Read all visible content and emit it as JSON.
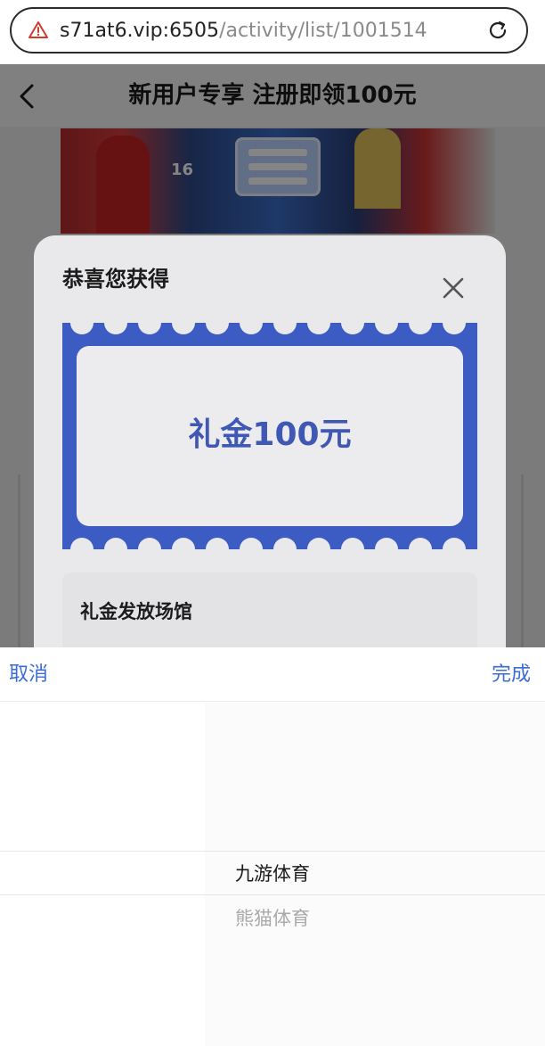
{
  "browser": {
    "url_host": "s71at6.vip:6505",
    "url_path": "/activity/list/1001514",
    "warn_icon": "warning-icon",
    "reload_icon": "reload-icon"
  },
  "page": {
    "title": "新用户专享 注册即领100元",
    "back_icon": "back-chevron-icon",
    "banner_number": "16"
  },
  "modal": {
    "title": "恭喜您获得",
    "close_icon": "close-icon",
    "amount": "礼金100元",
    "venue_label": "礼金发放场馆",
    "accent": "#3c5cc4"
  },
  "picker": {
    "cancel_label": "取消",
    "done_label": "完成",
    "options": [
      "九游体育",
      "熊猫体育"
    ],
    "selected": "九游体育",
    "accent": "#3a6bd6"
  }
}
